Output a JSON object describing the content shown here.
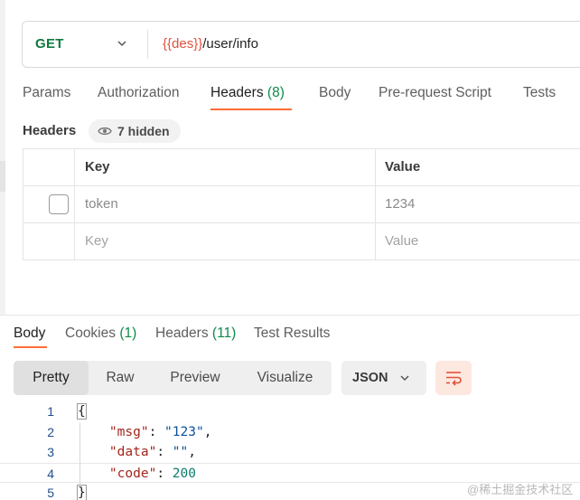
{
  "request": {
    "method": "GET",
    "url_variable": "{{des}}",
    "url_path": "/user/info"
  },
  "request_tabs": [
    {
      "label": "Params",
      "count": ""
    },
    {
      "label": "Authorization",
      "count": ""
    },
    {
      "label": "Headers",
      "count": "(8)"
    },
    {
      "label": "Body",
      "count": ""
    },
    {
      "label": "Pre-request Script",
      "count": ""
    },
    {
      "label": "Tests",
      "count": ""
    }
  ],
  "headers_section": {
    "title": "Headers",
    "hidden_label": "7 hidden",
    "columns": {
      "key": "Key",
      "value": "Value"
    },
    "rows": [
      {
        "key": "token",
        "value": "1234",
        "enabled": false
      }
    ],
    "new_row": {
      "key_placeholder": "Key",
      "value_placeholder": "Value"
    }
  },
  "response_tabs": [
    {
      "label": "Body",
      "count": ""
    },
    {
      "label": "Cookies",
      "count": "(1)"
    },
    {
      "label": "Headers",
      "count": "(11)"
    },
    {
      "label": "Test Results",
      "count": ""
    }
  ],
  "view_modes": [
    "Pretty",
    "Raw",
    "Preview",
    "Visualize"
  ],
  "format": "JSON",
  "code_lines": [
    {
      "n": "1",
      "parts": [
        {
          "t": "{",
          "c": "brace"
        }
      ]
    },
    {
      "n": "2",
      "parts": [
        {
          "t": "    ",
          "c": ""
        },
        {
          "t": "\"msg\"",
          "c": "key"
        },
        {
          "t": ": ",
          "c": ""
        },
        {
          "t": "\"123\"",
          "c": "str"
        },
        {
          "t": ",",
          "c": ""
        }
      ]
    },
    {
      "n": "3",
      "parts": [
        {
          "t": "    ",
          "c": ""
        },
        {
          "t": "\"data\"",
          "c": "key"
        },
        {
          "t": ": ",
          "c": ""
        },
        {
          "t": "\"\"",
          "c": "str"
        },
        {
          "t": ",",
          "c": ""
        }
      ]
    },
    {
      "n": "4",
      "parts": [
        {
          "t": "    ",
          "c": ""
        },
        {
          "t": "\"code\"",
          "c": "key"
        },
        {
          "t": ": ",
          "c": ""
        },
        {
          "t": "200",
          "c": "num"
        }
      ]
    },
    {
      "n": "5",
      "parts": [
        {
          "t": "}",
          "c": "brace"
        }
      ]
    }
  ],
  "watermark": "@稀土掘金技术社区",
  "colors": {
    "accent": "#ff6c37",
    "method_get": "#0e7a3e",
    "url_variable": "#e2513a",
    "count": "#0e8a4a"
  }
}
